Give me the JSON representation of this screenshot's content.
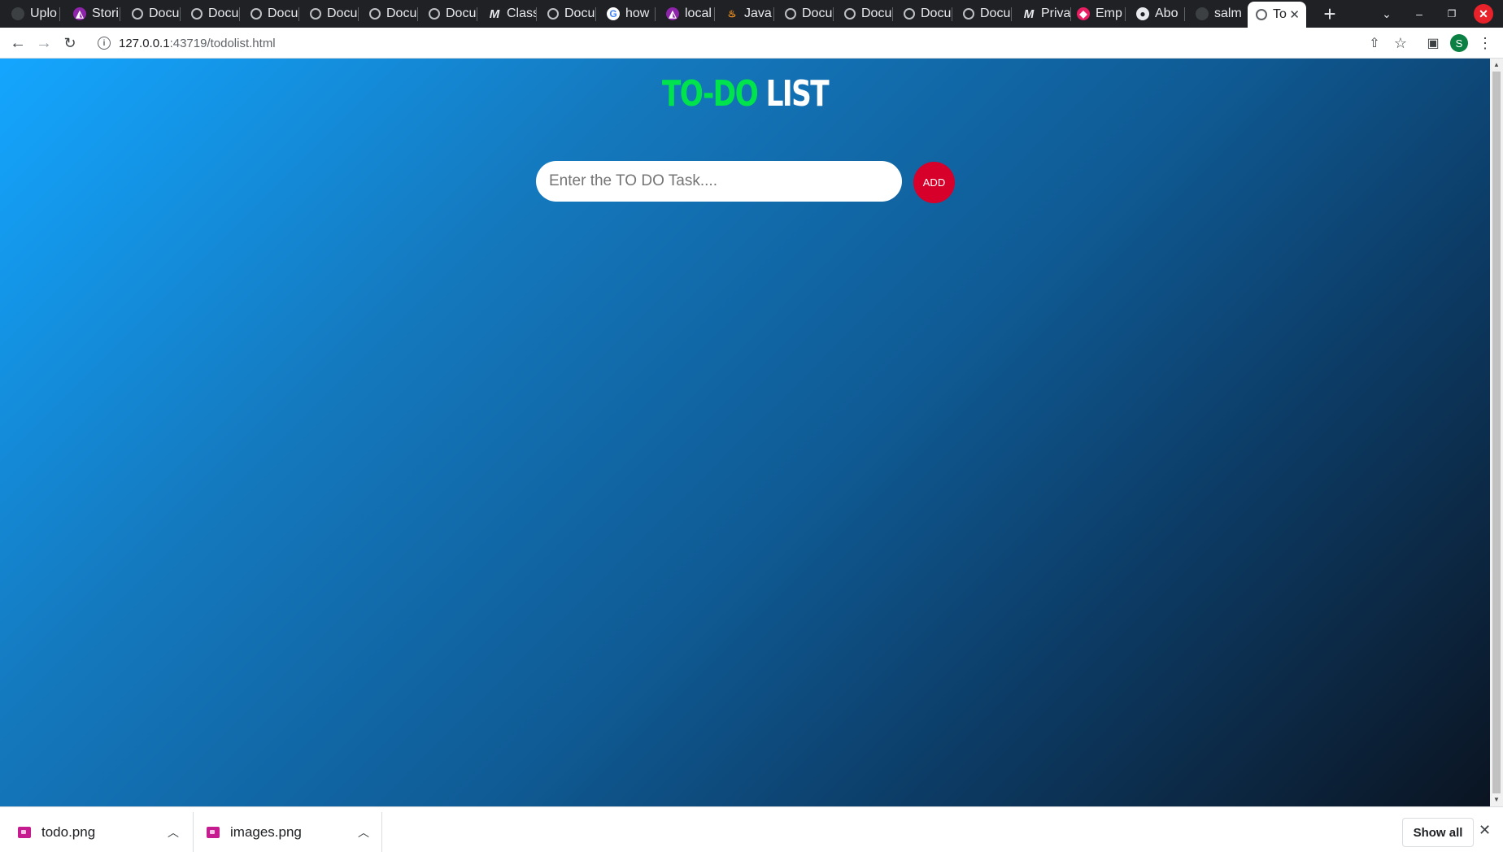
{
  "browser": {
    "tabs": [
      {
        "label": "Uplo",
        "icon": "github-icon"
      },
      {
        "label": "Stori",
        "icon": "purple-app-icon"
      },
      {
        "label": "Docu",
        "icon": "radio-icon"
      },
      {
        "label": "Docu",
        "icon": "radio-icon"
      },
      {
        "label": "Docu",
        "icon": "radio-icon"
      },
      {
        "label": "Docu",
        "icon": "radio-icon"
      },
      {
        "label": "Docu",
        "icon": "radio-icon"
      },
      {
        "label": "Docu",
        "icon": "radio-icon"
      },
      {
        "label": "Class",
        "icon": "medium-icon"
      },
      {
        "label": "Docu",
        "icon": "radio-icon"
      },
      {
        "label": "how",
        "icon": "google-icon"
      },
      {
        "label": "local",
        "icon": "purple-app-icon"
      },
      {
        "label": "Java",
        "icon": "java-icon"
      },
      {
        "label": "Docu",
        "icon": "radio-icon"
      },
      {
        "label": "Docu",
        "icon": "radio-icon"
      },
      {
        "label": "Docu",
        "icon": "radio-icon"
      },
      {
        "label": "Docu",
        "icon": "radio-icon"
      },
      {
        "label": "Priva",
        "icon": "medium-icon"
      },
      {
        "label": "Emp",
        "icon": "pink-app-icon"
      },
      {
        "label": "Abo",
        "icon": "github-icon"
      },
      {
        "label": "salm",
        "icon": "github-icon"
      },
      {
        "label": "To",
        "icon": "radio-icon",
        "active": true
      }
    ],
    "new_tab": "+",
    "url_host": "127.0.0.1",
    "url_path": ":43719/todolist.html",
    "profile_initial": "S"
  },
  "page": {
    "title_part1": "TO-DO",
    "title_part2": "LIST",
    "input_placeholder": "Enter the TO DO Task....",
    "add_label": "ADD",
    "colors": {
      "title_accent": "#00e34c",
      "add_button": "#d6002a",
      "gradient_start": "#14a6ff",
      "gradient_end": "#0b1421"
    }
  },
  "downloads": {
    "items": [
      {
        "name": "todo.png"
      },
      {
        "name": "images.png"
      }
    ],
    "show_all": "Show all"
  }
}
